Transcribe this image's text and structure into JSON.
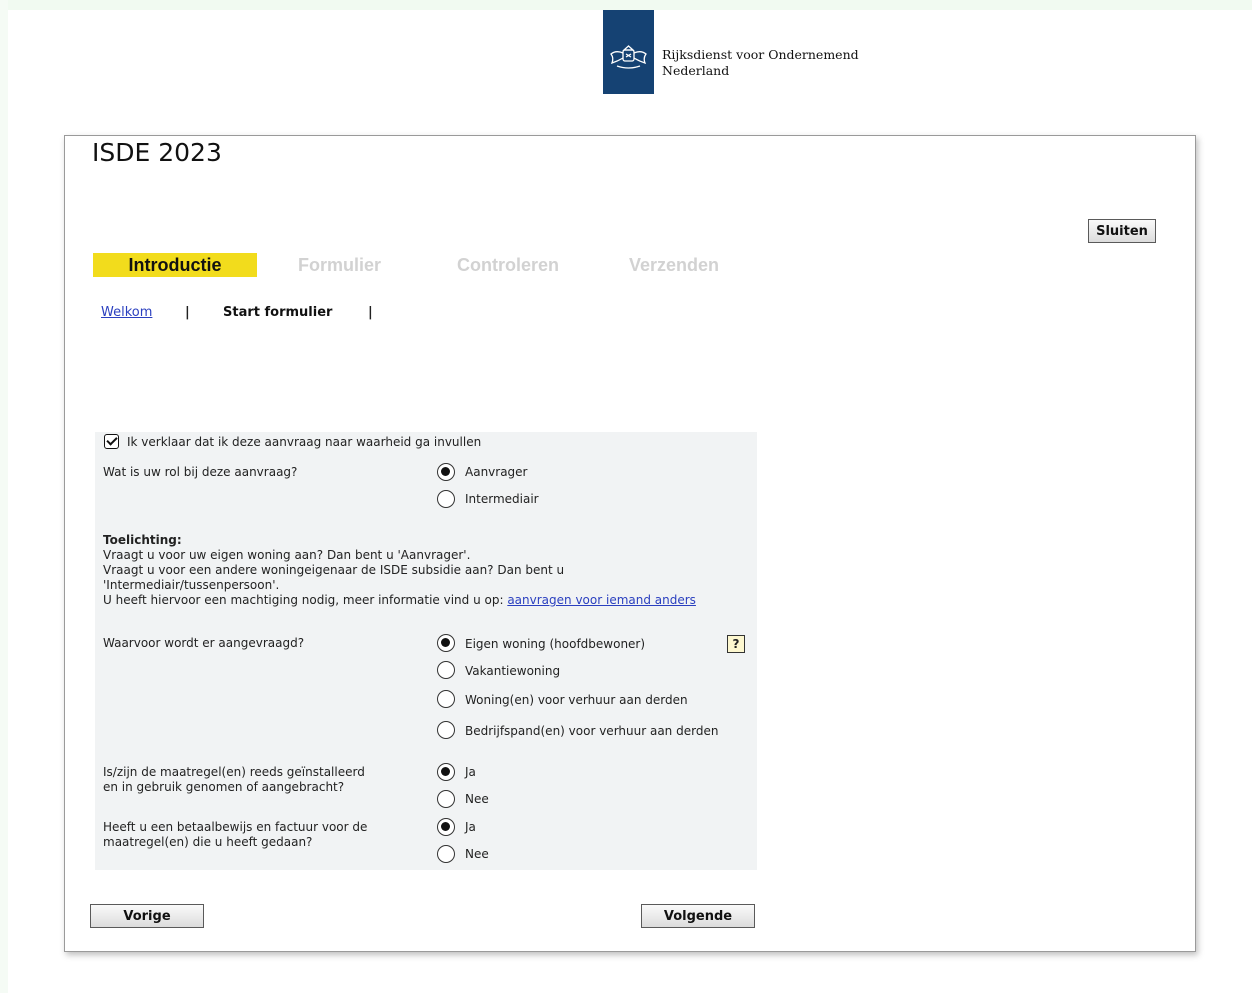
{
  "logo": {
    "line1": "Rijksdienst voor Ondernemend",
    "line2": "Nederland"
  },
  "page": {
    "title": "ISDE 2023",
    "close_label": "Sluiten"
  },
  "steps": [
    "Introductie",
    "Formulier",
    "Controleren",
    "Verzenden"
  ],
  "subnav": {
    "welcome": "Welkom",
    "separator": "|",
    "current": "Start formulier"
  },
  "form": {
    "declaration": "Ik verklaar dat ik deze aanvraag naar waarheid ga invullen",
    "role": {
      "question": "Wat is uw rol bij deze aanvraag?",
      "options": [
        "Aanvrager",
        "Intermediair"
      ],
      "selected": "Aanvrager"
    },
    "explanation": {
      "heading": "Toelichting:",
      "line1": "Vraagt u voor uw eigen woning aan? Dan bent u 'Aanvrager'.",
      "line2": "Vraagt u voor een andere woningeigenaar de ISDE subsidie aan? Dan bent u",
      "line3": "'Intermediair/tussenpersoon'.",
      "line4": "U heeft hiervoor een machtiging nodig, meer informatie vind u op:",
      "link": "aanvragen voor iemand anders"
    },
    "purpose": {
      "question": "Waarvoor wordt er aangevraagd?",
      "options": [
        "Eigen woning (hoofdbewoner)",
        "Vakantiewoning",
        "Woning(en) voor verhuur aan derden",
        "Bedrijfspand(en) voor verhuur aan derden"
      ],
      "selected": "Eigen woning (hoofdbewoner)",
      "help": "?"
    },
    "installed": {
      "question_line1": "Is/zijn de maatregel(en) reeds geïnstalleerd",
      "question_line2": "en in gebruik genomen of aangebracht?",
      "options": [
        "Ja",
        "Nee"
      ],
      "selected": "Ja"
    },
    "invoice": {
      "question_line1": "Heeft u een betaalbewijs en factuur voor de",
      "question_line2": "maatregel(en) die u heeft gedaan?",
      "options": [
        "Ja",
        "Nee"
      ],
      "selected": "Ja"
    }
  },
  "nav": {
    "prev": "Vorige",
    "next": "Volgende"
  },
  "colors": {
    "active_step": "#f2dc1c",
    "logo_blue": "#154273",
    "link": "#2a3fbf"
  }
}
